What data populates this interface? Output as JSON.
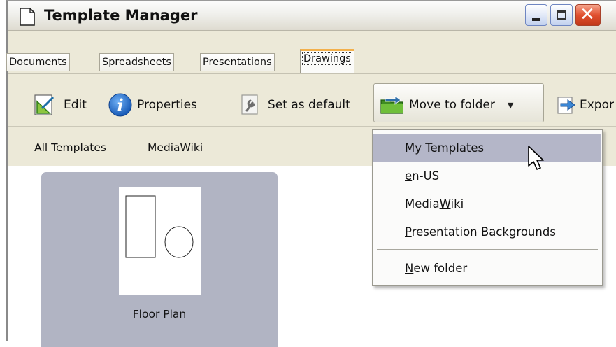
{
  "window": {
    "title": "Template Manager"
  },
  "tabs": [
    {
      "label": "Documents",
      "active": false
    },
    {
      "label": "Spreadsheets",
      "active": false
    },
    {
      "label": "Presentations",
      "active": false
    },
    {
      "label": "Drawings",
      "active": true
    }
  ],
  "toolbar": {
    "edit_label": "Edit",
    "properties_label": "Properties",
    "set_default_label": "Set as default",
    "move_to_folder_label": "Move to folder",
    "export_label": "Expor"
  },
  "folders": {
    "all_templates": "All Templates",
    "mediawiki": "MediaWiki"
  },
  "templates": [
    {
      "name": "Floor Plan"
    }
  ],
  "move_menu": {
    "items": [
      {
        "pre": "",
        "mnemonic": "M",
        "post": "y Templates",
        "highlighted": true
      },
      {
        "pre": "",
        "mnemonic": "e",
        "post": "n-US",
        "highlighted": false
      },
      {
        "pre": "Media",
        "mnemonic": "W",
        "post": "iki",
        "highlighted": false
      },
      {
        "pre": "",
        "mnemonic": "P",
        "post": "resentation Backgrounds",
        "highlighted": false
      }
    ],
    "new_folder": {
      "pre": "",
      "mnemonic": "N",
      "post": "ew folder"
    }
  },
  "colors": {
    "highlight": "#b4b6c8",
    "tile": "#b1b4c3",
    "active_tab_accent": "#f3b04b",
    "close_button": "#e1502f"
  },
  "icons": {
    "title": "document-icon",
    "edit": "edit-drawing-icon",
    "properties": "info-icon",
    "set_default": "wrench-icon",
    "move": "move-folder-icon",
    "export": "export-arrow-icon",
    "dropdown": "chevron-down-icon"
  }
}
